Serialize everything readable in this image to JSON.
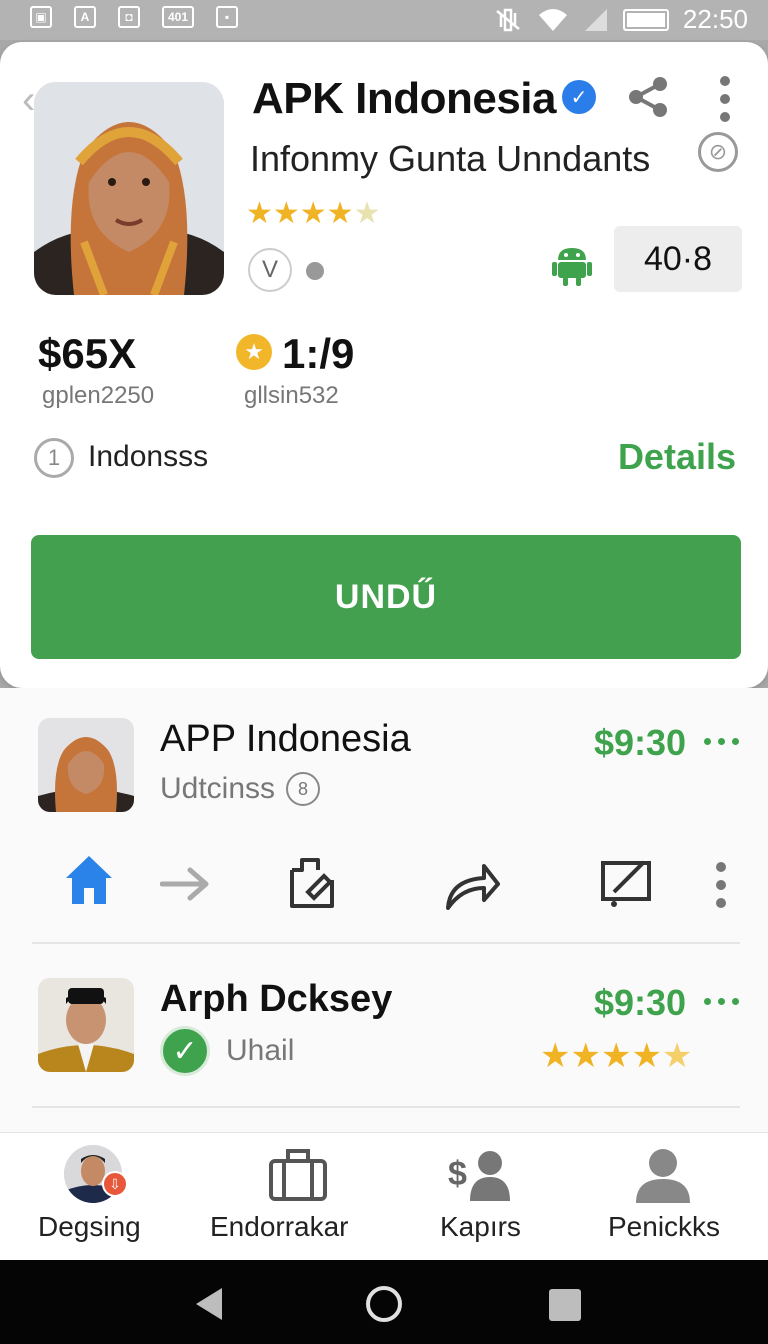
{
  "status_bar": {
    "time": "22:50",
    "left_icons": [
      "▣",
      "A",
      "◘",
      "401",
      "▪"
    ]
  },
  "app": {
    "title": "APK Indonesia",
    "subtitle": "Infonmy Gunta Unndants",
    "rating_value": "40·8",
    "rating_stars": 4.5,
    "badge_letter": "V",
    "price": "$65X",
    "price_sub": "gplen2250",
    "score": "1:/9",
    "score_sub": "gllsin532",
    "region_index": "1",
    "region": "Indonsss",
    "details_label": "Details",
    "install_label": "UNDŰ"
  },
  "list": [
    {
      "title": "APP Indonesia",
      "subtitle": "Udtcinss",
      "sub_icon": "8",
      "price": "$9:30"
    },
    {
      "title": "Arph Dcksey",
      "subtitle": "Uhail",
      "price": "$9:30",
      "stars": 4.5
    }
  ],
  "actions": [
    "home-icon",
    "arrow-right-icon",
    "clipboard-icon",
    "forward-icon",
    "edit-window-icon",
    "more-icon"
  ],
  "bottom_nav": [
    {
      "label": "Degsing",
      "icon": "avatar"
    },
    {
      "label": "Endorrakar",
      "icon": "briefcase-icon"
    },
    {
      "label": "Kapırs",
      "icon": "money-user-icon"
    },
    {
      "label": "Penickks",
      "icon": "person-icon"
    }
  ],
  "colors": {
    "accent_green": "#43a04f",
    "price_green": "#3fa34d",
    "verified_blue": "#2b7de9",
    "star_gold": "#f0b323",
    "home_blue": "#2a83e8"
  }
}
